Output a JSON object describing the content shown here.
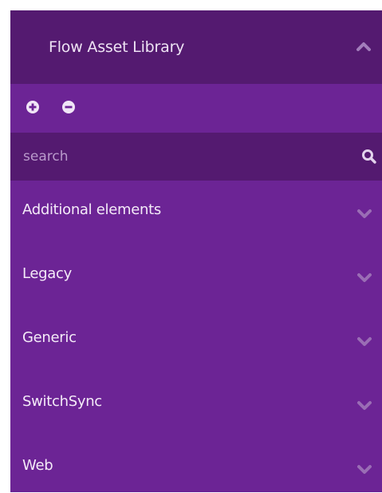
{
  "header": {
    "title": "Flow Asset Library",
    "collapse_icon": "chevron-up-icon"
  },
  "toolbar": {
    "expand_all_icon": "plus-circle-icon",
    "collapse_all_icon": "minus-circle-icon"
  },
  "search": {
    "placeholder": "search",
    "value": "",
    "icon": "search-icon"
  },
  "categories": [
    {
      "label": "Additional elements",
      "icon": "chevron-down-icon"
    },
    {
      "label": "Legacy",
      "icon": "chevron-down-icon"
    },
    {
      "label": "Generic",
      "icon": "chevron-down-icon"
    },
    {
      "label": "SwitchSync",
      "icon": "chevron-down-icon"
    },
    {
      "label": "Web",
      "icon": "chevron-down-icon"
    }
  ],
  "colors": {
    "header_bg": "#541a70",
    "panel_bg": "#6c2495",
    "icon_color": "#9a6db5",
    "text_color": "#f4ebf8"
  }
}
